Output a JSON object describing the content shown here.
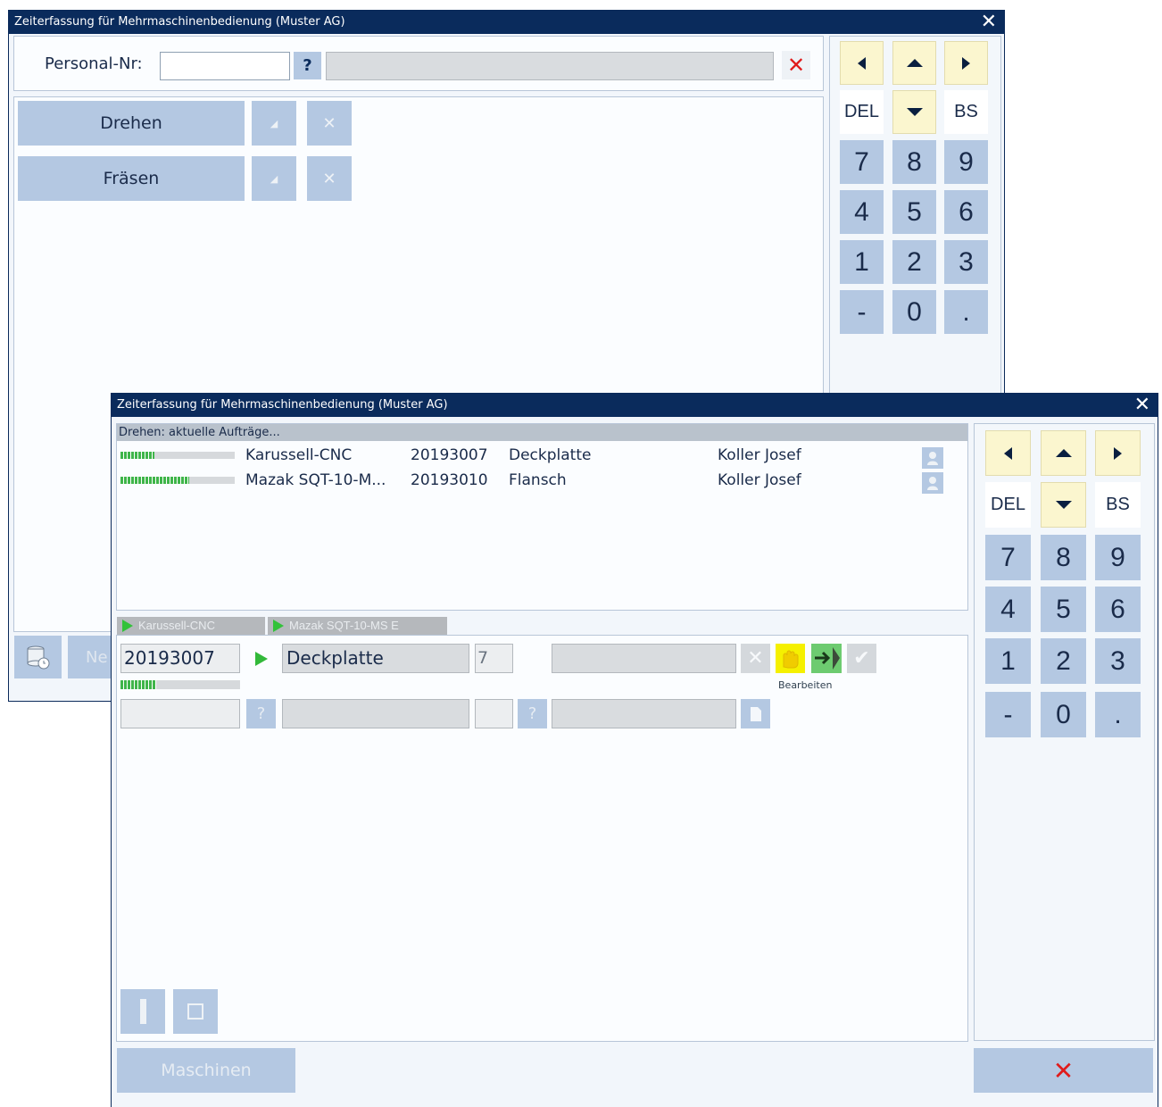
{
  "window1": {
    "title": "Zeiterfassung für Mehrmaschinenbedienung (Muster AG)",
    "close": "✕",
    "personal_label": "Personal-Nr:",
    "personal_value": "",
    "help_label": "?",
    "clear_label": "✕",
    "groups": [
      {
        "label": "Drehen",
        "edit": "◢",
        "remove": "✕"
      },
      {
        "label": "Fräsen",
        "edit": "◢",
        "remove": "✕"
      }
    ],
    "footer_button_partial": "Ne"
  },
  "keypad": {
    "del": "DEL",
    "bs": "BS",
    "digits": [
      "7",
      "8",
      "9",
      "4",
      "5",
      "6",
      "1",
      "2",
      "3",
      "-",
      "0",
      "."
    ]
  },
  "window2": {
    "title": "Zeiterfassung für Mehrmaschinenbedienung (Muster AG)",
    "close": "✕",
    "list_header": "Drehen: aktuelle Aufträge...",
    "orders": [
      {
        "machine": "Karussell-CNC",
        "order": "20193007",
        "part": "Deckplatte",
        "person": "Koller Josef",
        "progress": 0.3
      },
      {
        "machine": "Mazak SQT-10-M...",
        "order": "20193010",
        "part": "Flansch",
        "person": "Koller Josef",
        "progress": 0.6
      }
    ],
    "tabs": [
      {
        "label": "Karussell-CNC"
      },
      {
        "label": "Mazak SQT-10-MS E"
      }
    ],
    "detail": {
      "order": "20193007",
      "part": "Deckplatte",
      "qty": "7",
      "progress": 0.3,
      "action_label": "Bearbeiten",
      "help": "?"
    },
    "maschinen_label": "Maschinen",
    "cancel_label": "✕"
  },
  "colors": {
    "titlebar": "#0a2b5c",
    "button_blue": "#b4c8e2",
    "key_yellow": "#fbf6cf",
    "progress_green": "#3fb54a",
    "cancel_red": "#e01b1b"
  }
}
